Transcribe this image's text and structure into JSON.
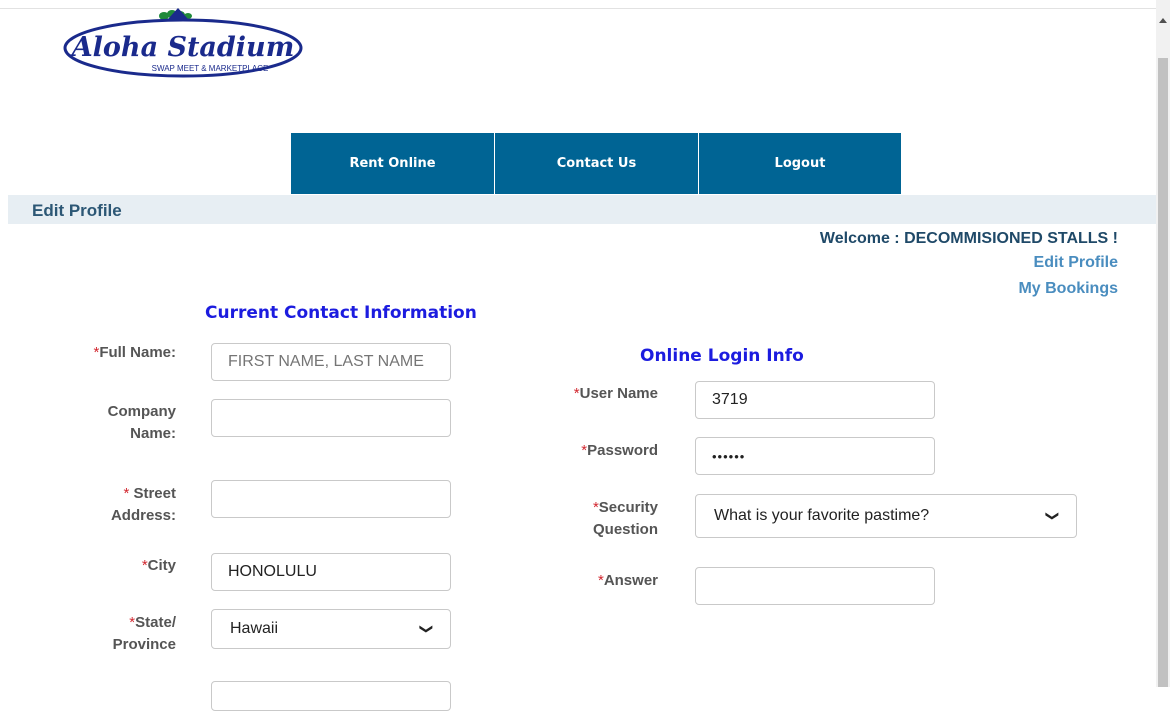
{
  "logo": {
    "title": "Aloha Stadium",
    "subtitle": "SWAP MEET & MARKETPLACE"
  },
  "nav": {
    "items": [
      "Rent Online",
      "Contact Us",
      "Logout"
    ]
  },
  "page_title": "Edit Profile",
  "welcome": {
    "text": "Welcome : DECOMMISIONED STALLS !",
    "edit_profile": "Edit Profile",
    "my_bookings": "My Bookings"
  },
  "contact": {
    "heading": "Current Contact Information",
    "required_mark": "*",
    "full_name": {
      "label": "Full Name:",
      "value": "",
      "placeholder": "FIRST NAME, LAST NAME"
    },
    "company": {
      "label_line1": "Company",
      "label_line2": "Name:",
      "value": ""
    },
    "street": {
      "label_line1": "Street",
      "label_line2": "Address:",
      "value": ""
    },
    "city": {
      "label": "City",
      "value": "HONOLULU"
    },
    "state": {
      "label_line1": "State/",
      "label_line2": "Province",
      "value": "Hawaii"
    }
  },
  "login": {
    "heading": "Online Login Info",
    "username": {
      "label": "User Name",
      "value": "3719"
    },
    "password": {
      "label": "Password",
      "value": "••••••"
    },
    "security": {
      "label_line1": "Security",
      "label_line2": "Question",
      "value": "What is your favorite pastime?"
    },
    "answer": {
      "label": "Answer",
      "value": ""
    }
  },
  "colors": {
    "nav_bg": "#006494",
    "heading": "#1c1cdf",
    "required": "#d2272f",
    "link": "#4a8dbf"
  },
  "icons": [
    "chevron-down-icon",
    "scroll-up-arrow-icon"
  ]
}
